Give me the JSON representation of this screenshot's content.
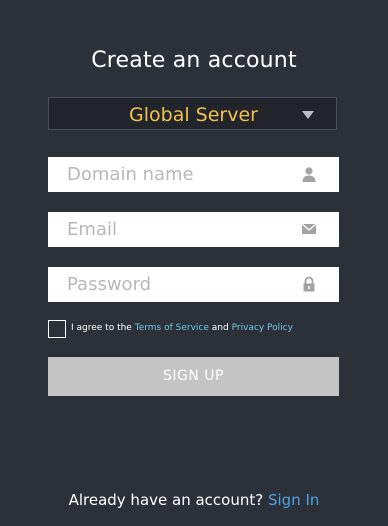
{
  "page": {
    "title": "Create an account"
  },
  "server": {
    "selected": "Global Server"
  },
  "fields": {
    "domain_placeholder": "Domain name",
    "email_placeholder": "Email",
    "password_placeholder": "Password"
  },
  "agreement": {
    "prefix": "I agree to the",
    "terms": "Terms of Service",
    "and": "and",
    "privacy": "Privacy Policy"
  },
  "actions": {
    "signup_label": "SIGN UP"
  },
  "footer": {
    "prompt": "Already have an account?",
    "signin_label": "Sign In"
  },
  "icons": {
    "domain": "person-icon",
    "email": "envelope-icon",
    "password": "lock-icon"
  },
  "colors": {
    "background": "#2c3039",
    "accent_yellow": "#f1c24a",
    "link_teal": "#6fc7e6",
    "link_blue": "#4ba3e0",
    "button_disabled": "#c4c4c4"
  }
}
